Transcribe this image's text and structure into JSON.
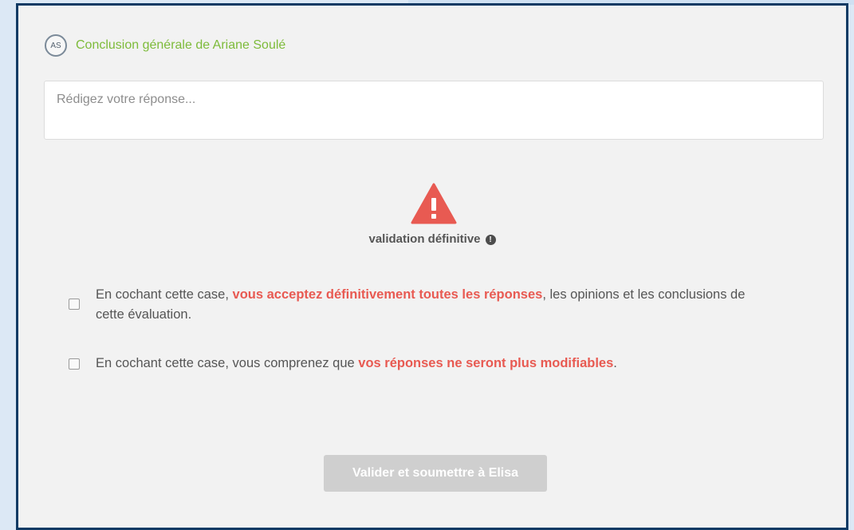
{
  "header": {
    "avatar_initials": "AS",
    "title": "Conclusion générale de Ariane Soulé"
  },
  "reply": {
    "placeholder": "Rédigez votre réponse..."
  },
  "validation": {
    "label": "validation définitive",
    "info_icon": "!"
  },
  "checks": [
    {
      "before": "En cochant cette case, ",
      "emphasis": "vous acceptez définitivement toutes les réponses",
      "after": ", les opinions et les conclusions de cette évaluation."
    },
    {
      "before": "En cochant cette case, vous comprenez que ",
      "emphasis": "vos réponses ne seront plus modifiables",
      "after": "."
    }
  ],
  "submit": {
    "label": "Valider et soumettre à Elisa"
  },
  "icons": {
    "warning": "warning-triangle-icon",
    "info": "info-circle-icon"
  },
  "colors": {
    "title_green": "#7dbb3a",
    "warning_red": "#e85a52",
    "panel_border": "#0f3a64",
    "button_disabled": "#cfcfcf"
  }
}
